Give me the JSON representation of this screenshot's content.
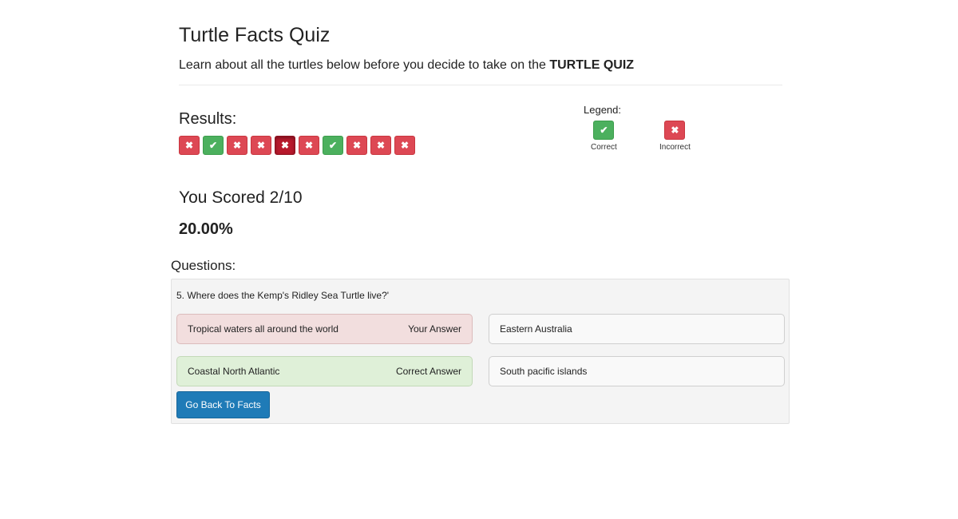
{
  "header": {
    "title": "Turtle Facts Quiz",
    "intro_text": "Learn about all the turtles below before you decide to take on the ",
    "intro_bold": "TURTLE QUIZ"
  },
  "results": {
    "heading": "Results:",
    "items": [
      {
        "status": "incorrect",
        "glyph": "✖"
      },
      {
        "status": "correct",
        "glyph": "✔"
      },
      {
        "status": "incorrect",
        "glyph": "✖"
      },
      {
        "status": "incorrect",
        "glyph": "✖"
      },
      {
        "status": "incorrect",
        "glyph": "✖",
        "active": true
      },
      {
        "status": "incorrect",
        "glyph": "✖"
      },
      {
        "status": "correct",
        "glyph": "✔"
      },
      {
        "status": "incorrect",
        "glyph": "✖"
      },
      {
        "status": "incorrect",
        "glyph": "✖"
      },
      {
        "status": "incorrect",
        "glyph": "✖"
      }
    ]
  },
  "legend": {
    "title": "Legend:",
    "correct_label": "Correct",
    "incorrect_label": "Incorrect",
    "correct_glyph": "✔",
    "incorrect_glyph": "✖",
    "correct_color": "#4cb05e",
    "incorrect_color": "#dd4854"
  },
  "score": {
    "text": "You Scored 2/10",
    "percent": "20.00%"
  },
  "questions": {
    "heading": "Questions:",
    "current": {
      "text": "5. Where does the Kemp's Ridley Sea Turtle live?'",
      "answers": [
        {
          "label": "Tropical waters all around the world",
          "tag": "Your Answer",
          "state": "wrong"
        },
        {
          "label": "Eastern Australia",
          "tag": "",
          "state": "neutral"
        },
        {
          "label": "Coastal North Atlantic",
          "tag": "Correct Answer",
          "state": "right"
        },
        {
          "label": "South pacific islands",
          "tag": "",
          "state": "neutral"
        }
      ]
    },
    "back_button_label": "Go Back To Facts"
  }
}
